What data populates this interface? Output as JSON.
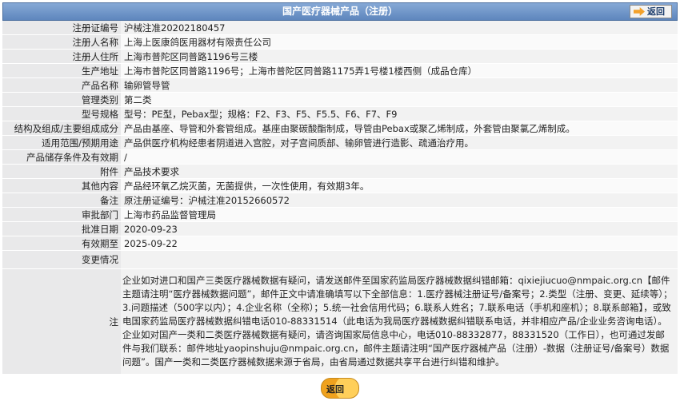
{
  "header": {
    "title": "国产医疗器械产品（注册）",
    "back_label": "返回"
  },
  "rows": [
    {
      "label": "注册证编号",
      "value": "沪械注准20202180457"
    },
    {
      "label": "注册人名称",
      "value": "上海上医康鸽医用器材有限责任公司"
    },
    {
      "label": "注册人住所",
      "value": "上海市普陀区同普路1196号三楼"
    },
    {
      "label": "生产地址",
      "value": "上海市普陀区同普路1196号；上海市普陀区同普路1175弄1号楼1楼西侧（成品仓库）"
    },
    {
      "label": "产品名称",
      "value": "输卵管导管"
    },
    {
      "label": "管理类别",
      "value": "第二类"
    },
    {
      "label": "型号规格",
      "value": "型号：PE型，Pebax型；规格：F2、F3、F5、F5.5、F6、F7、F9"
    },
    {
      "label": "结构及组成/主要组成成分",
      "value": "产品由基座、导管和外套管组成。基座由聚碳酸酯制成，导管由Pebax或聚乙烯制成，外套管由聚氯乙烯制成。"
    },
    {
      "label": "适用范围/预期用途",
      "value": "产品供医疗机构经患者阴道进入宫腔，对子宫间质部、输卵管进行造影、疏通治疗用。"
    },
    {
      "label": "产品储存条件及有效期",
      "value": "/"
    },
    {
      "label": "附件",
      "value": "产品技术要求"
    },
    {
      "label": "其他内容",
      "value": "产品经环氧乙烷灭菌，无菌提供，一次性使用，有效期3年。"
    },
    {
      "label": "备注",
      "value": "原注册证编号：沪械注准20152660572"
    },
    {
      "label": "审批部门",
      "value": "上海市药品监督管理局"
    },
    {
      "label": "批准日期",
      "value": "2020-09-23"
    },
    {
      "label": "有效期至",
      "value": "2025-09-22"
    },
    {
      "label": "变更情况",
      "value": ""
    }
  ],
  "note": {
    "label": "注",
    "text": "企业如对进口和国产三类医疗器械数据有疑问，请发送邮件至国家药监局医疗器械数据纠错邮箱：qixiejiucuo@nmpaic.org.cn【邮件主题请注明“医疗器械数据问题”，邮件正文中请准确填写以下全部信息：1.医疗器械注册证号/备案号；2.类型（注册、变更、延续等）；3.问题描述（500字以内）；4.企业名称（全称）；5.统一社会信用代码；6.联系人姓名；7.联系电话（手机和座机）；8.联系邮箱】，或致电国家药监局医疗器械数据纠错电话010-88331514（此电话为我局医疗器械数据纠错联系电话，并非相应产品/企业业务咨询电话）。企业如对国产一类和二类医疗器械数据有疑问，请咨询国家局信息中心，电话010-88332877，88331520（工作日），也可通过发邮件与我们联系：邮件地址yaopinshuju@nmpaic.org.cn，邮件主题请注明“国产医疗器械产品（注册）-数据（注册证号/备案号）数据问题”。国产一类和二类医疗器械数据来源于省局，由省局通过数据共享平台进行纠错和维护。"
  },
  "footer": {
    "back_label": "返回"
  }
}
